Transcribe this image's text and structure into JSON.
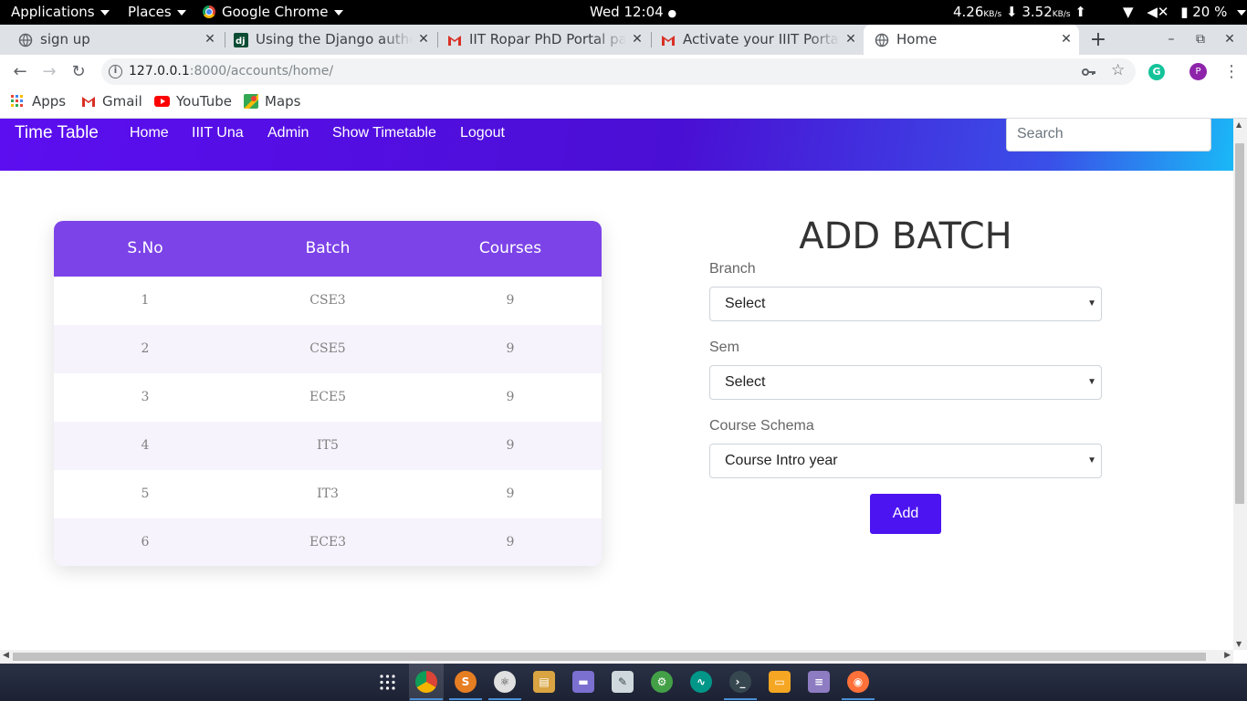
{
  "system_bar": {
    "applications": "Applications",
    "places": "Places",
    "app_name": "Google Chrome",
    "clock": "Wed 12:04",
    "down_speed": "4.26",
    "up_speed": "3.52",
    "speed_unit": "KB/s",
    "battery": "20 %"
  },
  "tabs": [
    {
      "title": "sign up"
    },
    {
      "title": "Using the Django authentication system"
    },
    {
      "title": "IIT Ropar PhD Portal password"
    },
    {
      "title": "Activate your IIIT Portal account"
    },
    {
      "title": "Home"
    }
  ],
  "window_controls": {
    "minimize": "–",
    "restore": "⧉",
    "close": "✕"
  },
  "address_bar": {
    "host": "127.0.0.1",
    "path": ":8000/accounts/home/"
  },
  "profile_initial": "P",
  "bookmarks": [
    {
      "label": "Apps"
    },
    {
      "label": "Gmail"
    },
    {
      "label": "YouTube"
    },
    {
      "label": "Maps"
    }
  ],
  "site": {
    "brand": "Time Table",
    "nav": [
      "Home",
      "IIIT Una",
      "Admin",
      "Show Timetable",
      "Logout"
    ],
    "search_placeholder": "Search",
    "table": {
      "headers": [
        "S.No",
        "Batch",
        "Courses"
      ],
      "rows": [
        [
          "1",
          "CSE3",
          "9"
        ],
        [
          "2",
          "CSE5",
          "9"
        ],
        [
          "3",
          "ECE5",
          "9"
        ],
        [
          "4",
          "IT5",
          "9"
        ],
        [
          "5",
          "IT3",
          "9"
        ],
        [
          "6",
          "ECE3",
          "9"
        ]
      ]
    },
    "form": {
      "title": "ADD BATCH",
      "branch_label": "Branch",
      "branch_value": "Select",
      "sem_label": "Sem",
      "sem_value": "Select",
      "schema_label": "Course Schema",
      "schema_value": "Course Intro year",
      "submit": "Add"
    }
  },
  "colors": {
    "navbar_start": "#5c0ef0",
    "navbar_end": "#1ab9f7",
    "table_header": "#7c43e8",
    "add_button": "#4c14f0"
  }
}
